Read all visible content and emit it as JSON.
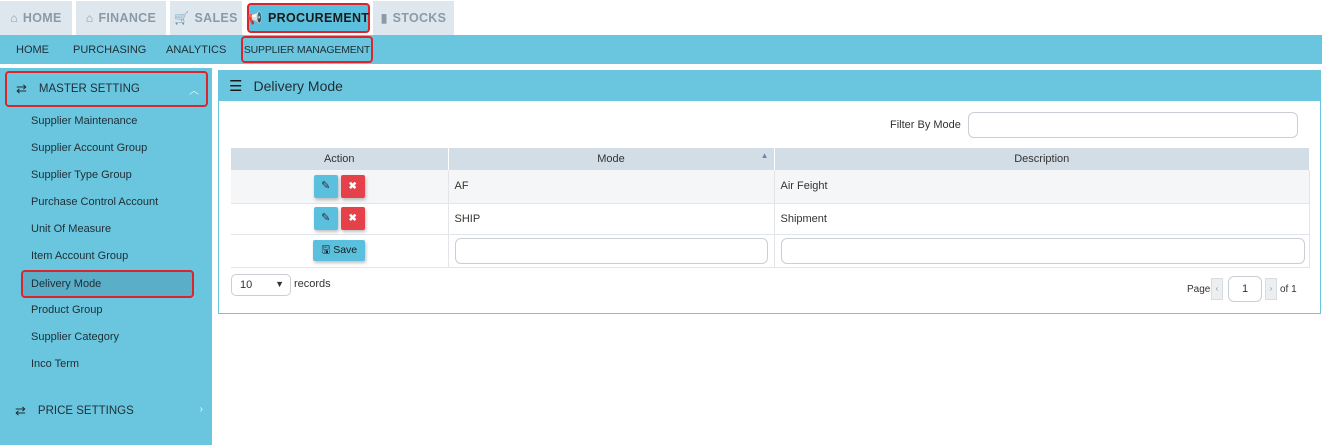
{
  "top_tabs": [
    {
      "label": "HOME",
      "icon": "home-icon",
      "glyph": "⌂"
    },
    {
      "label": "FINANCE",
      "icon": "bank-icon",
      "glyph": "🏛"
    },
    {
      "label": "SALES",
      "icon": "cart-icon",
      "glyph": "🛒"
    },
    {
      "label": "PROCUREMENT",
      "icon": "bullhorn-icon",
      "glyph": "📢"
    },
    {
      "label": "STOCKS",
      "icon": "bar-chart-icon",
      "glyph": "▮"
    }
  ],
  "subnav": {
    "home": "HOME",
    "purchasing": "PURCHASING",
    "analytics": "ANALYTICS",
    "supplier_management": "SUPPLIER MANAGEMENT"
  },
  "sidebar": {
    "master_setting": "MASTER SETTING",
    "items": [
      "Supplier Maintenance",
      "Supplier Account Group",
      "Supplier Type Group",
      "Purchase Control Account",
      "Unit Of Measure",
      "Item Account Group",
      "Delivery Mode",
      "Product Group",
      "Supplier Category",
      "Inco Term"
    ],
    "active_item": "Delivery Mode",
    "price_settings": "PRICE SETTINGS"
  },
  "panel": {
    "title": "Delivery Mode",
    "filter_label": "Filter By Mode",
    "filter_value": ""
  },
  "table": {
    "headers": {
      "action": "Action",
      "mode": "Mode",
      "description": "Description"
    },
    "rows": [
      {
        "mode": "AF",
        "description": "Air Feight"
      },
      {
        "mode": "SHIP",
        "description": "Shipment"
      }
    ],
    "save_label": "Save"
  },
  "pagination": {
    "page_size": "10",
    "records_label": "records",
    "page_label": "Page",
    "current_page": "1",
    "of_label": "of 1"
  },
  "colors": {
    "accent": "#6ac6de",
    "highlight_border": "#d9262c",
    "delete_button": "#e5414a"
  }
}
